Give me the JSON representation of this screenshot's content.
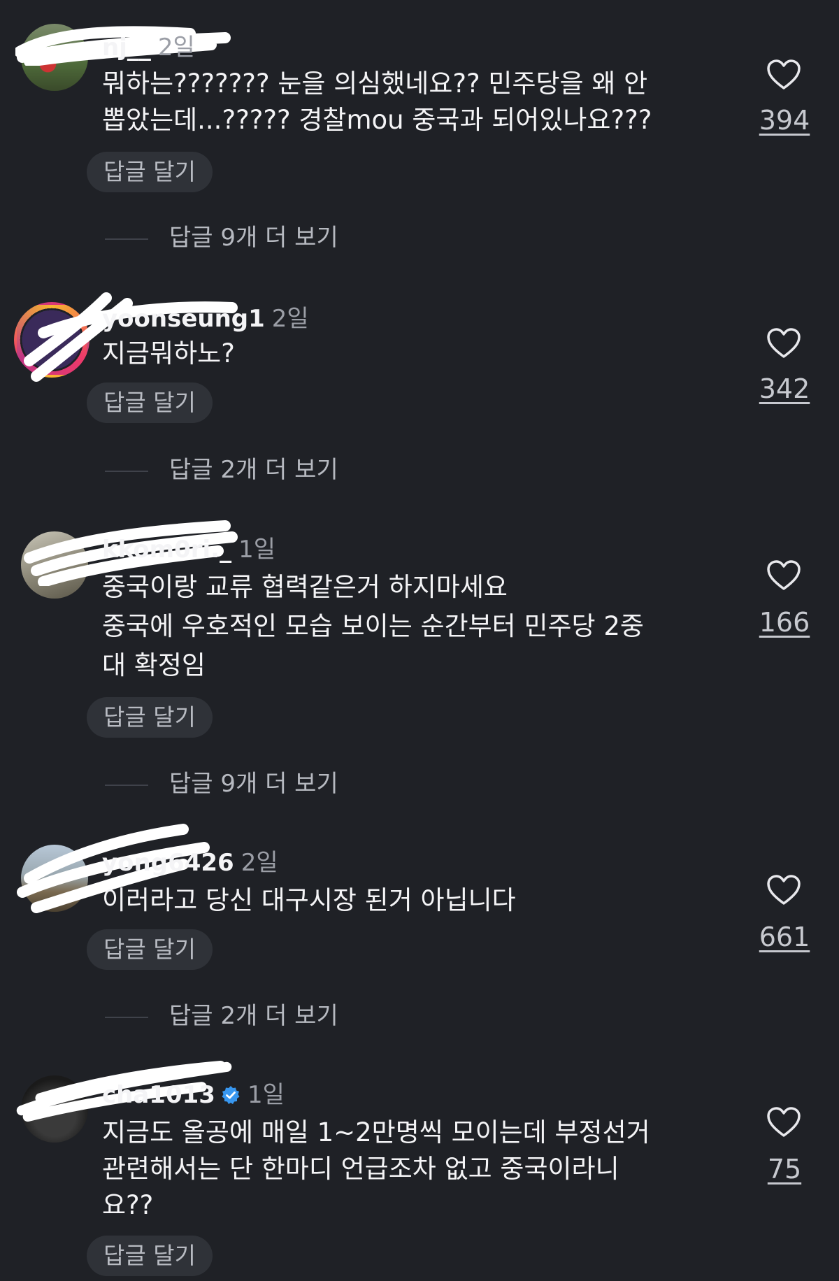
{
  "comments": [
    {
      "username": "nj__",
      "time": "2일",
      "verified": false,
      "text": "뭐하는??????? 눈을 의심했네요?? 민주당을 왜 안\n뽑았는데...????? 경찰mou 중국과 되어있나요???",
      "likes": "394",
      "reply_label": "답글 달기",
      "more_replies": "답글 9개 더 보기"
    },
    {
      "username": "yoonseung1",
      "time": "2일",
      "verified": false,
      "text": "지금뭐하노?",
      "likes": "342",
      "reply_label": "답글 달기",
      "more_replies": "답글 2개 더 보기"
    },
    {
      "username": "kkom0ri._",
      "time": "1일",
      "verified": false,
      "text": "중국이랑 교류 협력같은거 하지마세요\n중국에 우호적인 모습 보이는 순간부터 민주당 2중\n대 확정임",
      "likes": "166",
      "reply_label": "답글 달기",
      "more_replies": "답글 9개 더 보기"
    },
    {
      "username": "yong6426",
      "time": "2일",
      "verified": false,
      "text": "이러라고 당신 대구시장 된거 아닙니다",
      "likes": "661",
      "reply_label": "답글 달기",
      "more_replies": "답글 2개 더 보기"
    },
    {
      "username": "cha1013",
      "time": "1일",
      "verified": true,
      "text": "지금도 올공에 매일 1~2만명씩 모이는데 부정선거\n관련해서는 단 한마디 언급조차 없고 중국이라니\n요??",
      "likes": "75",
      "reply_label": "답글 달기",
      "more_replies": ""
    }
  ],
  "colors": {
    "background": "#1f2126",
    "verified_badge": "#3897f0"
  },
  "icons": {
    "like": "heart-outline-icon",
    "verified": "verified-badge-icon"
  }
}
